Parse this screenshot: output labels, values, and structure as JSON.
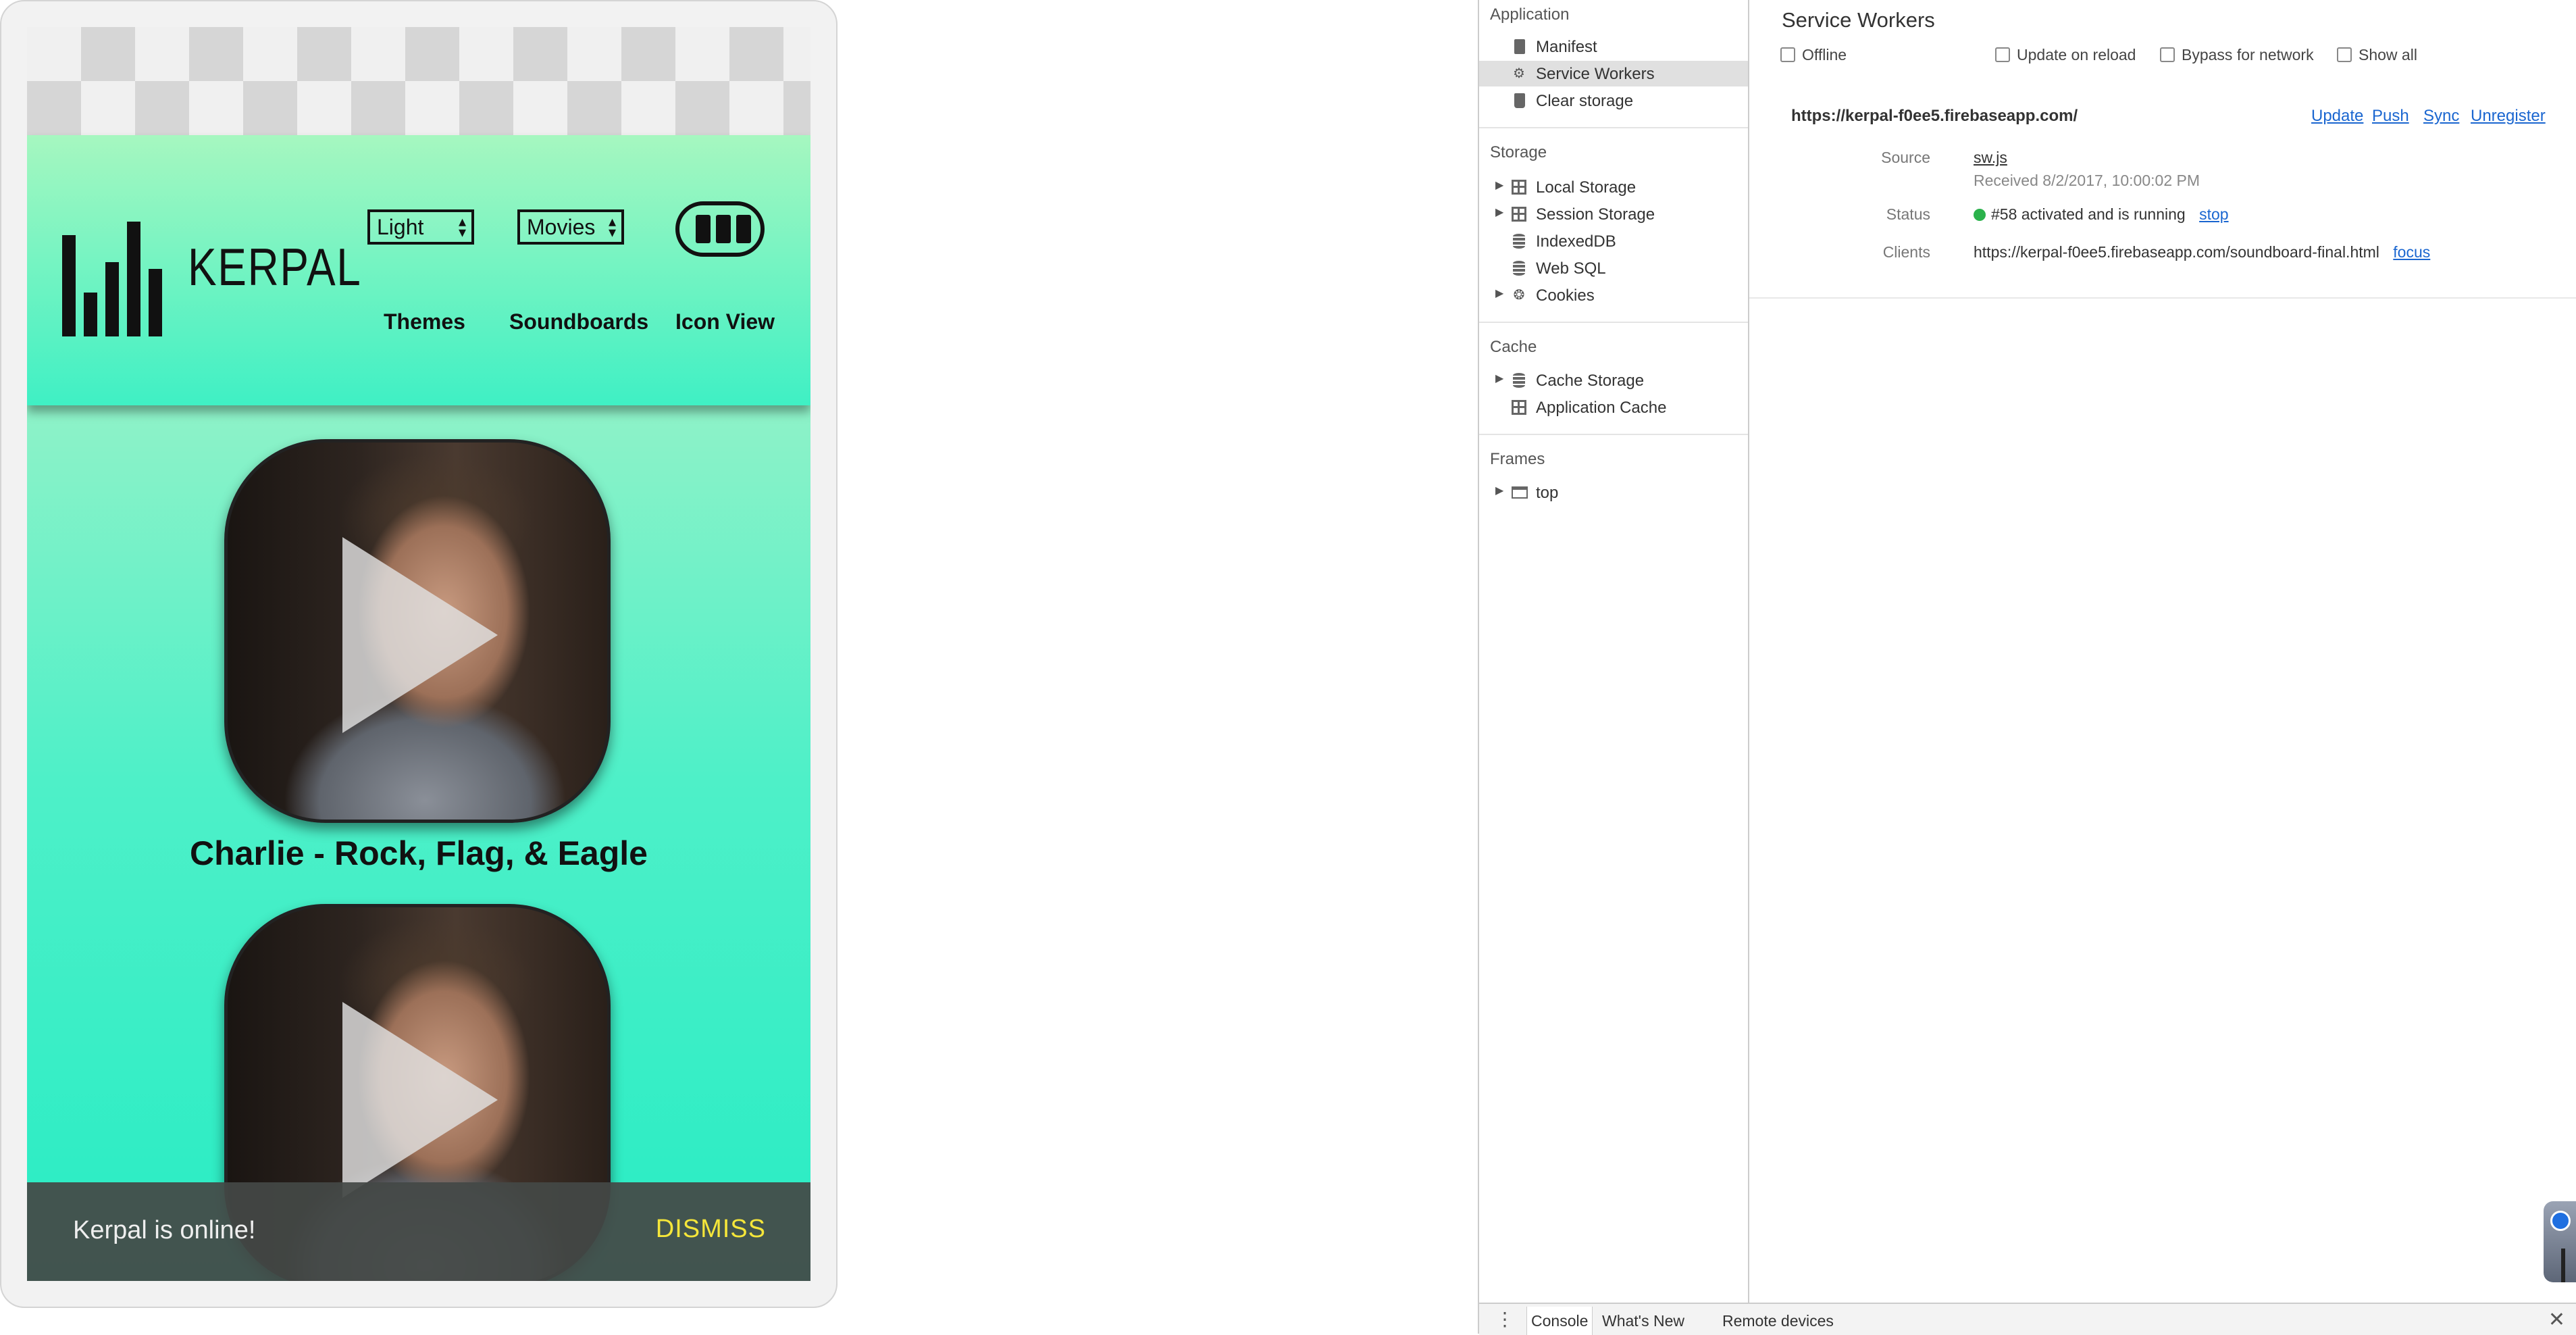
{
  "app": {
    "brand": "KERPAL",
    "theme_select": "Light",
    "category_select": "Movies",
    "nav_themes": "Themes",
    "nav_soundboards": "Soundboards",
    "nav_icon_view": "Icon View",
    "cards": [
      {
        "title": "Charlie - Rock, Flag, & Eagle"
      },
      {
        "title": ""
      }
    ],
    "snackbar": {
      "message": "Kerpal is online!",
      "action": "DISMISS"
    },
    "colors": {
      "gradient_top": "#b2f7c2",
      "gradient_bottom": "#27ecc4",
      "snackbar_action": "#f5e63a"
    }
  },
  "devtools": {
    "sidebar": {
      "application_header": "Application",
      "application_items": [
        "Manifest",
        "Service Workers",
        "Clear storage"
      ],
      "storage_header": "Storage",
      "storage_items": [
        "Local Storage",
        "Session Storage",
        "IndexedDB",
        "Web SQL",
        "Cookies"
      ],
      "cache_header": "Cache",
      "cache_items": [
        "Cache Storage",
        "Application Cache"
      ],
      "frames_header": "Frames",
      "frames_items": [
        "top"
      ]
    },
    "panel": {
      "title": "Service Workers",
      "checkboxes": [
        "Offline",
        "Update on reload",
        "Bypass for network",
        "Show all"
      ],
      "worker_url": "https://kerpal-f0ee5.firebaseapp.com/",
      "actions": [
        "Update",
        "Push",
        "Sync",
        "Unregister"
      ],
      "source_label": "Source",
      "source_file": "sw.js",
      "received": "Received 8/2/2017, 10:00:02 PM",
      "status_label": "Status",
      "status_text": "#58 activated and is running",
      "status_action": "stop",
      "clients_label": "Clients",
      "clients_url": "https://kerpal-f0ee5.firebaseapp.com/soundboard-final.html",
      "clients_action": "focus",
      "status_color": "#2bb24c"
    },
    "drawer": {
      "tabs": [
        "Console",
        "What's New",
        "Remote devices"
      ]
    }
  }
}
